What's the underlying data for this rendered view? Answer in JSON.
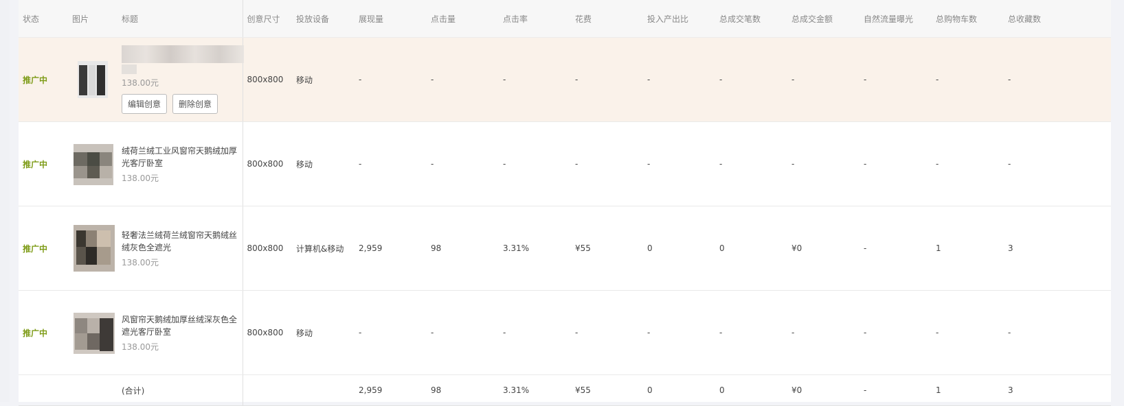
{
  "headers": [
    "状态",
    "图片",
    "标题",
    "创意尺寸",
    "投放设备",
    "展现量",
    "点击量",
    "点击率",
    "花费",
    "投入产出比",
    "总成交笔数",
    "总成交金额",
    "自然流量曝光",
    "总购物车数",
    "总收藏数"
  ],
  "rows": [
    {
      "status": "推广中",
      "title": "",
      "price": "138.00元",
      "size": "800x800",
      "device": "移动",
      "impressions": "-",
      "clicks": "-",
      "ctr": "-",
      "cost": "-",
      "roi": "-",
      "orders": "-",
      "gmv": "-",
      "natural": "-",
      "cart": "-",
      "fav": "-",
      "edit_label": "编辑创意",
      "delete_label": "删除创意"
    },
    {
      "status": "推广中",
      "title": "绒荷兰绒工业风窗帘天鹅绒加厚光客厅卧室",
      "price": "138.00元",
      "size": "800x800",
      "device": "移动",
      "impressions": "-",
      "clicks": "-",
      "ctr": "-",
      "cost": "-",
      "roi": "-",
      "orders": "-",
      "gmv": "-",
      "natural": "-",
      "cart": "-",
      "fav": "-"
    },
    {
      "status": "推广中",
      "title": "轻奢法兰绒荷兰绒窗帘天鹅绒丝绒灰色全遮光",
      "price": "138.00元",
      "size": "800x800",
      "device": "计算机&移动",
      "impressions": "2,959",
      "clicks": "98",
      "ctr": "3.31%",
      "cost": "¥55",
      "roi": "0",
      "orders": "0",
      "gmv": "¥0",
      "natural": "-",
      "cart": "1",
      "fav": "3"
    },
    {
      "status": "推广中",
      "title": "风窗帘天鹅绒加厚丝绒深灰色全遮光客厅卧室",
      "price": "138.00元",
      "size": "800x800",
      "device": "移动",
      "impressions": "-",
      "clicks": "-",
      "ctr": "-",
      "cost": "-",
      "roi": "-",
      "orders": "-",
      "gmv": "-",
      "natural": "-",
      "cart": "-",
      "fav": "-"
    }
  ],
  "total": {
    "label": "(合计)",
    "impressions": "2,959",
    "clicks": "98",
    "ctr": "3.31%",
    "cost": "¥55",
    "roi": "0",
    "orders": "0",
    "gmv": "¥0",
    "natural": "-",
    "cart": "1",
    "fav": "3"
  },
  "colors": {
    "status_green": "#7d9b16",
    "highlight_row": "#faf2ea"
  }
}
